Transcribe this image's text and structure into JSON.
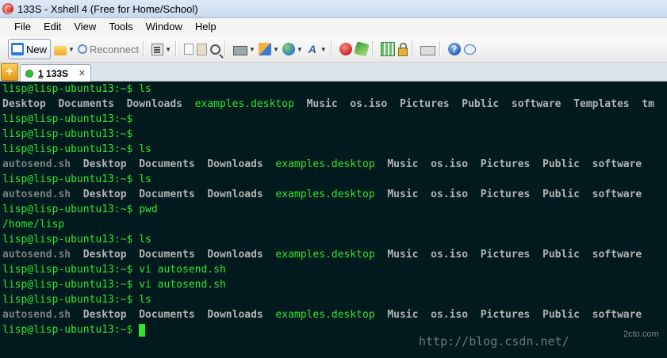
{
  "window": {
    "title": "133S - Xshell 4 (Free for Home/School)",
    "icon": "xshell-icon"
  },
  "menu": [
    "File",
    "Edit",
    "View",
    "Tools",
    "Window",
    "Help"
  ],
  "toolbar": {
    "new_label": "New",
    "reconnect_label": "Reconnect"
  },
  "tab": {
    "number": "1",
    "name": "133S",
    "status_color": "#2fbf3a"
  },
  "terminal": {
    "prompt": "lisp@lisp-ubuntu13:~$",
    "lines": [
      {
        "cmd": "ls"
      },
      {
        "output": [
          "Desktop",
          "Documents",
          "Downloads",
          "examples.desktop",
          "Music",
          "os.iso",
          "Pictures",
          "Public",
          "software",
          "Templates",
          "tm"
        ]
      },
      {
        "cmd": ""
      },
      {
        "cmd": ""
      },
      {
        "cmd": "ls"
      },
      {
        "output": [
          "autosend.sh",
          "Desktop",
          "Documents",
          "Downloads",
          "examples.desktop",
          "Music",
          "os.iso",
          "Pictures",
          "Public",
          "software"
        ]
      },
      {
        "cmd": "ls"
      },
      {
        "output": [
          "autosend.sh",
          "Desktop",
          "Documents",
          "Downloads",
          "examples.desktop",
          "Music",
          "os.iso",
          "Pictures",
          "Public",
          "software"
        ]
      },
      {
        "cmd": "pwd"
      },
      {
        "text": "/home/lisp"
      },
      {
        "cmd": "ls"
      },
      {
        "output": [
          "autosend.sh",
          "Desktop",
          "Documents",
          "Downloads",
          "examples.desktop",
          "Music",
          "os.iso",
          "Pictures",
          "Public",
          "software"
        ]
      },
      {
        "cmd": "vi autosend.sh"
      },
      {
        "cmd": "vi autosend.sh"
      },
      {
        "cmd": "ls"
      },
      {
        "output": [
          "autosend.sh",
          "Desktop",
          "Documents",
          "Downloads",
          "examples.desktop",
          "Music",
          "os.iso",
          "Pictures",
          "Public",
          "software"
        ]
      },
      {
        "cmd": "",
        "cursor": true
      }
    ],
    "colors": {
      "background": "#001a1d",
      "prompt": "#2ee62e",
      "directory": "#b3b3b3",
      "executable": "#2ee62e",
      "script": "#7f7f7f"
    }
  },
  "watermark": {
    "url": "http://blog.csdn.net/",
    "logo": "2cto.com"
  }
}
